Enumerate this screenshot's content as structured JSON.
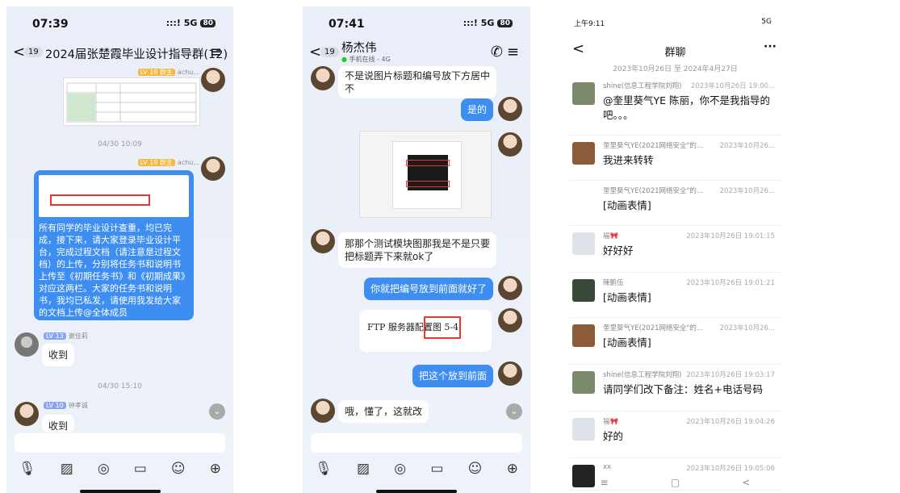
{
  "phone1": {
    "time": "07:39",
    "signal": ":::! 5G",
    "battery": "80",
    "back_count": "19",
    "title": "2024届张楚霞毕业设计指导群(12)",
    "sender_top": "achu...",
    "lv_badge_top": "LV 19 群主",
    "timestamp1": "04/30 10:09",
    "sender_mid": "achu...",
    "lv_badge_mid": "LV 19 群主",
    "long_message": "所有同学的毕业设计查重，均已完成，接下来，请大家登录毕业设计平台，完成过程文档（请注意是过程文档）的上传，分别将任务书和说明书上传至《初期任务书》和《初期成果》对应这两栏。大家的任务书和说明书，我均已私发，请使用我发给大家的文档上传@全体成员",
    "user1_lv": "LV 13",
    "user1_name": "谢佳莉",
    "reply1": "收到",
    "timestamp2": "04/30 15:10",
    "user2_lv": "LV 10",
    "user2_name": "钟孝诚",
    "reply2": "收到"
  },
  "phone2": {
    "time": "07:41",
    "signal": ":::! 5G",
    "battery": "80",
    "back_count": "19",
    "title": "杨杰伟",
    "subtitle": "手机在线 - 4G",
    "msg1": "不是说图片标题和编号放下方居中不",
    "msg2": "是的",
    "msg3": "那那个测试模块图那我是不是只要把标题弄下来就ok了",
    "msg4": "你就把编号放到前面就好了",
    "msg5": "FTP 服务器配置图 5-4",
    "msg6": "把这个放到前面",
    "msg7": "哦，懂了，这就改"
  },
  "phone3": {
    "status_time": "上午9:11",
    "status_right": "5G",
    "title": "群聊",
    "range": "2023年10月26日 至 2024年4月27日",
    "rows": [
      {
        "name": "shine(信息工程学院刘翔)",
        "date": "2023年10月26日 19:00...",
        "msg": "@奎里葵气YE 陈丽，你不是我指导的吧。。。"
      },
      {
        "name": "奎里葵气YE(2021网络安全\"的...",
        "date": "2023年10月26...",
        "msg": "我进来转转"
      },
      {
        "name": "奎里葵气YE(2021网络安全\"的...",
        "date": "2023年10月26...",
        "msg": "[动画表情]"
      },
      {
        "name": "福🎀",
        "date": "2023年10月26日 19:01:15",
        "msg": "好好好"
      },
      {
        "name": "陳鹏伍",
        "date": "2023年10月26日 19:01:21",
        "msg": "[动画表情]"
      },
      {
        "name": "奎里葵气YE(2021网络安全\"的...",
        "date": "2023年10月26...",
        "msg": "[动画表情]"
      },
      {
        "name": "shine(信息工程学院刘翔)",
        "date": "2023年10月26日 19:03:17",
        "msg": "请同学们改下备注：姓名+电话号码"
      },
      {
        "name": "福🎀",
        "date": "2023年10月26日 19:04:26",
        "msg": "好的"
      },
      {
        "name": "xx",
        "date": "2023年10月26日 19:05:06",
        "msg": ""
      }
    ]
  }
}
